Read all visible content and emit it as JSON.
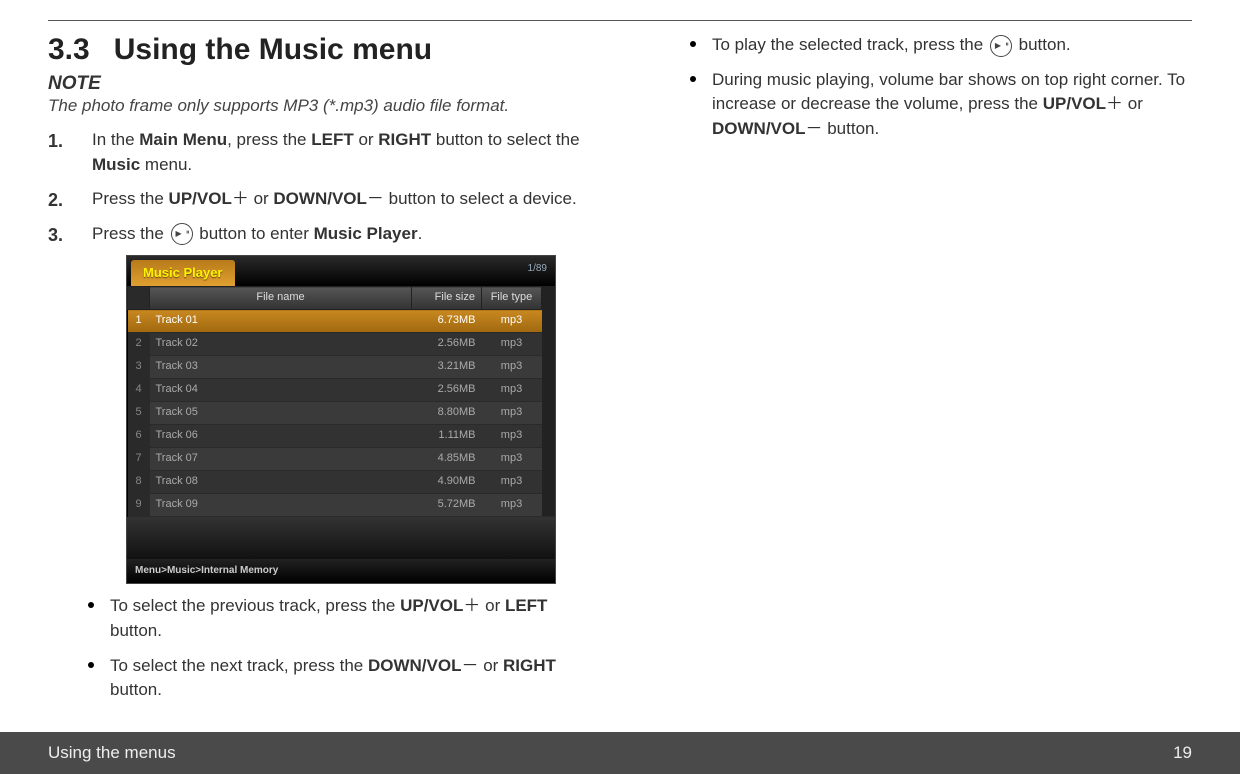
{
  "heading": {
    "num": "3.3",
    "title": "Using the Music menu"
  },
  "note": {
    "head": "NOTE",
    "body": "The photo frame only supports MP3 (*.mp3) audio file format."
  },
  "steps": {
    "s1a": "In the ",
    "s1b": "Main Menu",
    "s1c": ", press the ",
    "s1d": "LEFT",
    "s1e": " or ",
    "s1f": "RIGHT",
    "s1g": " button to select the ",
    "s1h": "Music",
    "s1i": " menu.",
    "s2a": "Press the ",
    "s2b": "UP/VOL",
    "s2plus": "＋",
    "s2c": " or ",
    "s2d": "DOWN/VOL",
    "s2minus": "－",
    "s2e": " button to select a device.",
    "s3a": "Press the ",
    "s3b": " button to enter ",
    "s3c": "Music Player",
    "s3d": "."
  },
  "player": {
    "tab": "Music Player",
    "count": "1/89",
    "cols": {
      "name": "File  name",
      "size": "File  size",
      "type": "File  type"
    },
    "rows": [
      {
        "i": "1",
        "name": "Track 01",
        "size": "6.73MB",
        "type": "mp3"
      },
      {
        "i": "2",
        "name": "Track 02",
        "size": "2.56MB",
        "type": "mp3"
      },
      {
        "i": "3",
        "name": "Track 03",
        "size": "3.21MB",
        "type": "mp3"
      },
      {
        "i": "4",
        "name": "Track 04",
        "size": "2.56MB",
        "type": "mp3"
      },
      {
        "i": "5",
        "name": "Track 05",
        "size": "8.80MB",
        "type": "mp3"
      },
      {
        "i": "6",
        "name": "Track 06",
        "size": "1.11MB",
        "type": "mp3"
      },
      {
        "i": "7",
        "name": "Track 07",
        "size": "4.85MB",
        "type": "mp3"
      },
      {
        "i": "8",
        "name": "Track 08",
        "size": "4.90MB",
        "type": "mp3"
      },
      {
        "i": "9",
        "name": "Track 09",
        "size": "5.72MB",
        "type": "mp3"
      }
    ],
    "breadcrumb": "Menu>Music>Internal Memory"
  },
  "bullets": {
    "b1a": "To select the previous track, press the ",
    "b1b": "UP/VOL",
    "b1plus": "＋",
    "b1c": " or ",
    "b1d": "LEFT",
    "b1e": " button.",
    "b2a": "To select the next track, press the ",
    "b2b": "DOWN/VOL",
    "b2minus": "－",
    "b2c": " or ",
    "b2d": "RIGHT",
    "b2e": " button.",
    "b3a": "To play the selected track, press the ",
    "b3b": " button.",
    "b4a": "During music playing, volume bar shows on top right corner. To increase or decrease the volume, press the ",
    "b4b": "UP/VOL",
    "b4plus": "＋",
    "b4c": " or ",
    "b4d": "DOWN/VOL",
    "b4minus": "－",
    "b4e": " button."
  },
  "footer": {
    "left": "Using the menus",
    "right": "19"
  }
}
